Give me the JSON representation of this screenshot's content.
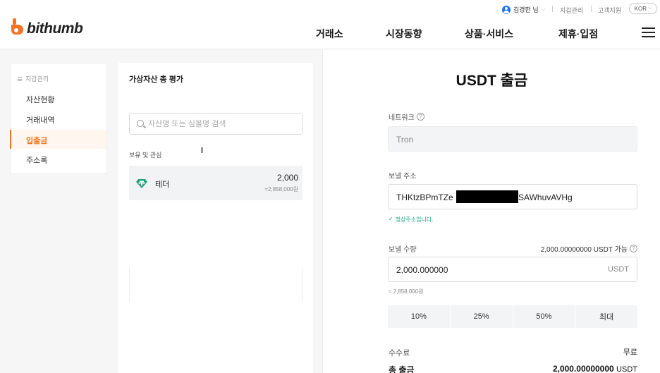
{
  "utility": {
    "user_name": "김경한 님",
    "wallet_link": "지갑관리",
    "support_link": "고객지원",
    "language": "KOR"
  },
  "header": {
    "logo_text": "bithumb",
    "nav": [
      "거래소",
      "시장동향",
      "상품·서비스",
      "제휴·입점"
    ]
  },
  "sidebar": {
    "heading": "지갑관리",
    "items": [
      "자산현황",
      "거래내역",
      "입출금",
      "주소록"
    ],
    "active": "입출금"
  },
  "assets": {
    "title": "가상자산 총 평가",
    "search_placeholder": "자산명 또는 심볼명 검색",
    "holdings_label": "보유 및 관심",
    "coin": {
      "name": "테더",
      "amount": "2,000",
      "krw": "≈2,858,000원",
      "icon": "tether-icon"
    }
  },
  "withdraw": {
    "title": "USDT 출금",
    "network_label": "네트워크",
    "network_value": "Tron",
    "address_label": "보낼 주소",
    "address_prefix": "THKtzBPmTZe",
    "address_suffix": "SAWhuvAVHg",
    "address_valid_msg": "정상주소입니다.",
    "amount_label": "보낼 수량",
    "available": "2,000.00000000 USDT 가능",
    "amount_value": "2,000.000000",
    "amount_unit": "USDT",
    "amount_krw": "≈ 2,858,000원",
    "percent_buttons": [
      "10%",
      "25%",
      "50%",
      "최대"
    ],
    "fee_label": "수수료",
    "fee_value": "무료",
    "total_label": "총 출금",
    "total_value": "2,000.00000000",
    "total_unit": "USDT"
  },
  "colors": {
    "brand_orange": "#f37321",
    "valid_green": "#14a87e",
    "user_blue": "#1e73e8"
  }
}
